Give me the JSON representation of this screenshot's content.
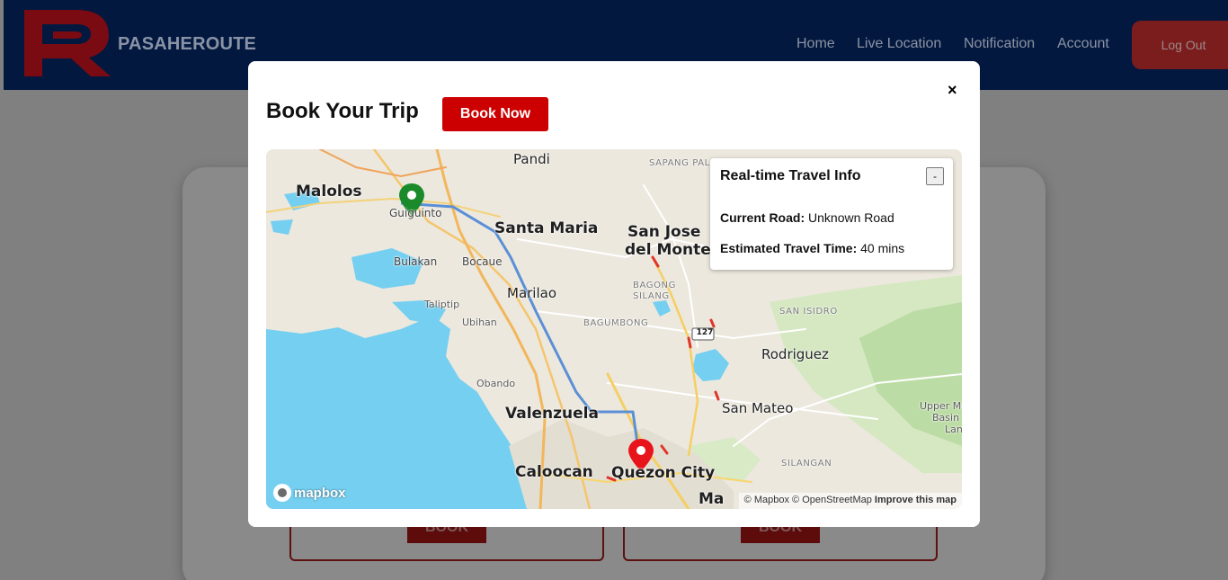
{
  "navbar": {
    "brand": "PASAHEROUTE",
    "links": [
      "Home",
      "Live Location",
      "Notification",
      "Account"
    ],
    "logout_label": "Log Out"
  },
  "background_cards": {
    "book_label": "BOOK"
  },
  "modal": {
    "title": "Book Your Trip",
    "book_now_label": "Book Now",
    "close_symbol": "×"
  },
  "map": {
    "places": {
      "pandi": "Pandi",
      "sapang_palay": "SAPANG PALAY",
      "malolos": "Malolos",
      "guiguinto": "Guiguinto",
      "santa_maria": "Santa Maria",
      "san_jose_del_monte_1": "San Jose",
      "san_jose_del_monte_2": "del Monte",
      "bulakan": "Bulakan",
      "bocaue": "Bocaue",
      "marilao": "Marilao",
      "bagong_silang_1": "BAGONG",
      "bagong_silang_2": "SILANG",
      "taliptip": "Taliptip",
      "ubihan": "Ubihan",
      "bagumbong": "BAGUMBONG",
      "san_isidro": "SAN ISIDRO",
      "rodriguez": "Rodriguez",
      "obando": "Obando",
      "valenzuela": "Valenzuela",
      "san_mateo": "San Mateo",
      "upper_marikina_1": "Upper Ma",
      "upper_marikina_2": "Basin I",
      "upper_marikina_3": "Lan",
      "silangan": "SILANGAN",
      "caloocan": "Caloocan",
      "quezon_city": "Quezon City",
      "marikina_partial": "Ma",
      "route_shield": "127"
    },
    "mapbox_label": "mapbox",
    "attribution": {
      "mapbox": "© Mapbox",
      "osm": "© OpenStreetMap",
      "improve": "Improve this map"
    },
    "colors": {
      "water": "#75cff0",
      "land": "#ece8de",
      "park": "#cde6b9",
      "route": "#5b8fd6",
      "origin_marker": "#1a8a2a",
      "destination_marker": "#e8141b"
    }
  },
  "travel_info": {
    "title": "Real-time Travel Info",
    "minimize_label": "-",
    "current_road_label": "Current Road:",
    "current_road_value": "Unknown Road",
    "travel_time_label": "Estimated Travel Time:",
    "travel_time_value": "40 mins"
  }
}
